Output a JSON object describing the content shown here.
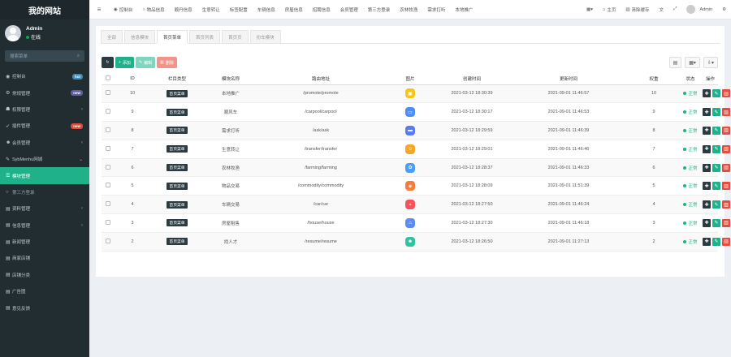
{
  "site_title": "我的网站",
  "user": {
    "name": "Admin",
    "status": "在线"
  },
  "sidebar": {
    "search_placeholder": "搜索菜单",
    "items": [
      {
        "label": "控制台",
        "icon": "dashboard-icon",
        "glyph": "◉",
        "badge": "hot",
        "badge_color": "#3c8dbc"
      },
      {
        "label": "常规管理",
        "icon": "cogs-icon",
        "glyph": "⚙",
        "badge": "new",
        "badge_color": "#605ca8"
      },
      {
        "label": "权限管理",
        "icon": "group-icon",
        "glyph": "☗",
        "chevron": "‹"
      },
      {
        "label": "插件管理",
        "icon": "rocket-icon",
        "glyph": "➶",
        "badge": "new",
        "badge_color": "#dd4b39"
      },
      {
        "label": "会员管理",
        "icon": "user-icon",
        "glyph": "☻",
        "chevron": "‹"
      },
      {
        "label": "SybMenhu网城",
        "icon": "leaf-icon",
        "glyph": "✎",
        "chevron": "⌄"
      },
      {
        "label": "模块管理",
        "icon": "list-icon",
        "glyph": "☰",
        "active": true
      },
      {
        "label": "第三方登录",
        "icon": "circle-icon",
        "glyph": "○",
        "sub": true
      },
      {
        "label": "资料管理",
        "icon": "file-icon",
        "glyph": "▤",
        "chevron": "‹"
      },
      {
        "label": "信息管理",
        "icon": "info-icon",
        "glyph": "▤",
        "chevron": "‹"
      },
      {
        "label": "新闻管理",
        "icon": "news-icon",
        "glyph": "▤"
      },
      {
        "label": "商家店铺",
        "icon": "shop-icon",
        "glyph": "▤"
      },
      {
        "label": "店铺分类",
        "icon": "category-icon",
        "glyph": "▤"
      },
      {
        "label": "广告图",
        "icon": "image-icon",
        "glyph": "▤"
      },
      {
        "label": "意见反馈",
        "icon": "feedback-icon",
        "glyph": "▤"
      }
    ]
  },
  "topnav": {
    "items": [
      {
        "label": "控制台",
        "icon": "dashboard-icon",
        "glyph": "◉"
      },
      {
        "label": "物品信息",
        "icon": "circle-icon",
        "glyph": "○"
      },
      {
        "label": "顺丹信息"
      },
      {
        "label": "生意转让"
      },
      {
        "label": "标签配置"
      },
      {
        "label": "车辆信息"
      },
      {
        "label": "房屋信息"
      },
      {
        "label": "招聘信息"
      },
      {
        "label": "会员管理"
      },
      {
        "label": "第三方登录"
      },
      {
        "label": "农林牧渔"
      },
      {
        "label": "需求打听"
      },
      {
        "label": "本地推广"
      }
    ],
    "home_label": "主页",
    "clear_cache_label": "清除缓存",
    "admin_label": "Admin"
  },
  "tabs": [
    "全部",
    "信息模块",
    "首页菜单",
    "首页列表",
    "首页页",
    "扮车模块"
  ],
  "active_tab": 2,
  "toolbar": {
    "add_label": "添加",
    "edit_label": "编辑",
    "delete_label": "删除"
  },
  "table": {
    "headers": [
      "ID",
      "栏目类型",
      "模块名称",
      "路由地址",
      "图片",
      "创建时间",
      "更新时间",
      "权重",
      "状态",
      "操作"
    ],
    "rows": [
      {
        "id": "10",
        "type": "首页菜单",
        "name": "本地推广",
        "route": "/promote/promote",
        "pic_color": "#f5c518",
        "pic_glyph": "▣",
        "pic_icon": "promote-icon",
        "created": "2021-03-12 18:30:39",
        "updated": "2021-09-01 11:46:57",
        "weight": "10",
        "status": "正常"
      },
      {
        "id": "9",
        "type": "首页菜单",
        "name": "顺风车",
        "route": "/carpool/carpool",
        "pic_color": "#4e8df5",
        "pic_glyph": "▭",
        "pic_icon": "carpool-icon",
        "created": "2021-03-12 18:30:17",
        "updated": "2021-09-01 11:46:53",
        "weight": "9",
        "status": "正常"
      },
      {
        "id": "8",
        "type": "首页菜单",
        "name": "需求打听",
        "route": "/ask/ask",
        "pic_color": "#5b7cf0",
        "pic_glyph": "▬",
        "pic_icon": "ask-icon",
        "created": "2021-03-12 18:29:59",
        "updated": "2021-09-01 11:46:39",
        "weight": "8",
        "status": "正常"
      },
      {
        "id": "7",
        "type": "首页菜单",
        "name": "生意转让",
        "route": "/transfer/transfer",
        "pic_color": "#f5a623",
        "pic_glyph": "☺",
        "pic_icon": "transfer-icon",
        "created": "2021-03-12 18:29:01",
        "updated": "2021-09-01 11:46:46",
        "weight": "7",
        "status": "正常"
      },
      {
        "id": "6",
        "type": "首页菜单",
        "name": "农林牧渔",
        "route": "/farming/farming",
        "pic_color": "#4a9ef5",
        "pic_glyph": "✿",
        "pic_icon": "farming-icon",
        "created": "2021-03-12 18:28:37",
        "updated": "2021-09-01 11:46:33",
        "weight": "6",
        "status": "正常"
      },
      {
        "id": "5",
        "type": "首页菜单",
        "name": "物品交易",
        "route": "/commodity/commodity",
        "pic_color": "#f57c3a",
        "pic_glyph": "◈",
        "pic_icon": "commodity-icon",
        "created": "2021-03-12 18:28:09",
        "updated": "2021-09-01 11:51:39",
        "weight": "5",
        "status": "正常"
      },
      {
        "id": "4",
        "type": "首页菜单",
        "name": "车辆交易",
        "route": "/car/car",
        "pic_color": "#f2545b",
        "pic_glyph": "◒",
        "pic_icon": "car-icon",
        "created": "2021-03-12 18:27:50",
        "updated": "2021-09-01 11:46:24",
        "weight": "4",
        "status": "正常"
      },
      {
        "id": "3",
        "type": "首页菜单",
        "name": "房屋租售",
        "route": "/house/house",
        "pic_color": "#5b8def",
        "pic_glyph": "⌂",
        "pic_icon": "house-icon",
        "created": "2021-03-12 18:27:30",
        "updated": "2021-09-01 11:46:18",
        "weight": "3",
        "status": "正常"
      },
      {
        "id": "2",
        "type": "首页菜单",
        "name": "找人才",
        "route": "/resume/resume",
        "pic_color": "#2ec4a0",
        "pic_glyph": "☻",
        "pic_icon": "resume-icon",
        "created": "2021-03-12 18:26:50",
        "updated": "2021-09-01 11:27:13",
        "weight": "2",
        "status": "正常"
      }
    ]
  },
  "colors": {
    "accent": "#1fb28a",
    "sidebar_bg": "#222d32",
    "danger": "#e74c3c",
    "dark_btn": "#2c3b41"
  }
}
